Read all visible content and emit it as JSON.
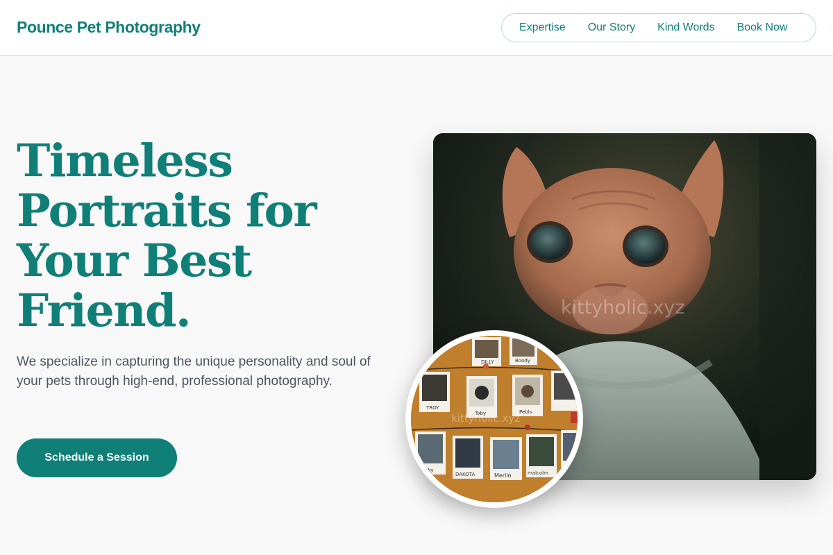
{
  "header": {
    "brand": "Pounce Pet Photography",
    "nav": [
      "Expertise",
      "Our Story",
      "Kind Words",
      "Book Now"
    ]
  },
  "hero": {
    "headline_lines": [
      "Timeless",
      "Portraits for",
      "Your Best",
      "Friend."
    ],
    "subhead": "We specialize in capturing the unique personality and soul of your pets through high-end, professional photography.",
    "cta_label": "Schedule a Session"
  },
  "images": {
    "main_photo": {
      "subject": "sphynx-cat-photo",
      "watermark": "kittyholic.xyz"
    },
    "inset_photo": {
      "subject": "polaroid-pet-wall-photo",
      "watermark": "kittyholic.xyz",
      "polaroid_captions": [
        "DILLY",
        "Boody",
        "TROY",
        "Toby",
        "Pebls",
        "DAKOTA",
        "Merlin",
        "malcolm",
        "Rocky"
      ]
    }
  },
  "colors": {
    "brand": "#0f7f78",
    "page_background": "#f8f8f8",
    "body_text": "#4b5560",
    "border": "#b9d9d4"
  }
}
